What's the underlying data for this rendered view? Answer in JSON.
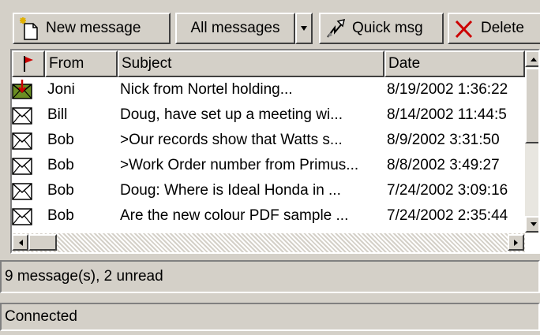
{
  "toolbar": {
    "new_message": "New message",
    "all_messages": "All messages",
    "quick_msg": "Quick msg",
    "delete": "Delete"
  },
  "list": {
    "columns": [
      "",
      "From",
      "Subject",
      "Date"
    ],
    "rows": [
      {
        "icon": "flagged-envelope-icon",
        "from": "Joni",
        "subject": "Nick from Nortel holding...",
        "date": "8/19/2002 1:36:22"
      },
      {
        "icon": "envelope-icon",
        "from": "Bill",
        "subject": "Doug, have set up a meeting wi...",
        "date": "8/14/2002 11:44:5"
      },
      {
        "icon": "envelope-icon",
        "from": "Bob",
        "subject": ">Our records show that Watts s...",
        "date": "8/9/2002 3:31:50"
      },
      {
        "icon": "envelope-icon",
        "from": "Bob",
        "subject": ">Work Order number from Primus...",
        "date": "8/8/2002 3:49:27"
      },
      {
        "icon": "envelope-icon",
        "from": "Bob",
        "subject": "Doug: Where is Ideal Honda in ...",
        "date": "7/24/2002 3:09:16"
      },
      {
        "icon": "envelope-icon",
        "from": "Bob",
        "subject": "Are the new colour PDF sample ...",
        "date": "7/24/2002 2:35:44"
      }
    ]
  },
  "status": {
    "messages": "9 message(s), 2 unread",
    "connection": "Connected"
  },
  "colors": {
    "face": "#d4d0c8",
    "flag": "#cc0000",
    "delete_x": "#cc0000"
  }
}
